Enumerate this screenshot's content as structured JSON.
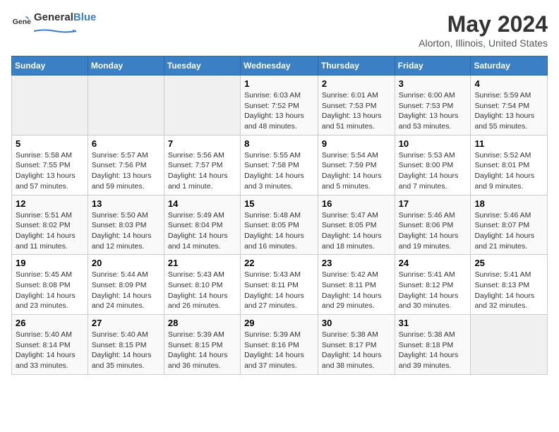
{
  "header": {
    "logo_general": "General",
    "logo_blue": "Blue",
    "title": "May 2024",
    "subtitle": "Alorton, Illinois, United States"
  },
  "days_of_week": [
    "Sunday",
    "Monday",
    "Tuesday",
    "Wednesday",
    "Thursday",
    "Friday",
    "Saturday"
  ],
  "weeks": [
    {
      "days": [
        {
          "number": "",
          "empty": true
        },
        {
          "number": "",
          "empty": true
        },
        {
          "number": "",
          "empty": true
        },
        {
          "number": "1",
          "sunrise": "6:03 AM",
          "sunset": "7:52 PM",
          "daylight": "13 hours and 48 minutes."
        },
        {
          "number": "2",
          "sunrise": "6:01 AM",
          "sunset": "7:53 PM",
          "daylight": "13 hours and 51 minutes."
        },
        {
          "number": "3",
          "sunrise": "6:00 AM",
          "sunset": "7:53 PM",
          "daylight": "13 hours and 53 minutes."
        },
        {
          "number": "4",
          "sunrise": "5:59 AM",
          "sunset": "7:54 PM",
          "daylight": "13 hours and 55 minutes."
        }
      ]
    },
    {
      "days": [
        {
          "number": "5",
          "sunrise": "5:58 AM",
          "sunset": "7:55 PM",
          "daylight": "13 hours and 57 minutes."
        },
        {
          "number": "6",
          "sunrise": "5:57 AM",
          "sunset": "7:56 PM",
          "daylight": "13 hours and 59 minutes."
        },
        {
          "number": "7",
          "sunrise": "5:56 AM",
          "sunset": "7:57 PM",
          "daylight": "14 hours and 1 minute."
        },
        {
          "number": "8",
          "sunrise": "5:55 AM",
          "sunset": "7:58 PM",
          "daylight": "14 hours and 3 minutes."
        },
        {
          "number": "9",
          "sunrise": "5:54 AM",
          "sunset": "7:59 PM",
          "daylight": "14 hours and 5 minutes."
        },
        {
          "number": "10",
          "sunrise": "5:53 AM",
          "sunset": "8:00 PM",
          "daylight": "14 hours and 7 minutes."
        },
        {
          "number": "11",
          "sunrise": "5:52 AM",
          "sunset": "8:01 PM",
          "daylight": "14 hours and 9 minutes."
        }
      ]
    },
    {
      "days": [
        {
          "number": "12",
          "sunrise": "5:51 AM",
          "sunset": "8:02 PM",
          "daylight": "14 hours and 11 minutes."
        },
        {
          "number": "13",
          "sunrise": "5:50 AM",
          "sunset": "8:03 PM",
          "daylight": "14 hours and 12 minutes."
        },
        {
          "number": "14",
          "sunrise": "5:49 AM",
          "sunset": "8:04 PM",
          "daylight": "14 hours and 14 minutes."
        },
        {
          "number": "15",
          "sunrise": "5:48 AM",
          "sunset": "8:05 PM",
          "daylight": "14 hours and 16 minutes."
        },
        {
          "number": "16",
          "sunrise": "5:47 AM",
          "sunset": "8:05 PM",
          "daylight": "14 hours and 18 minutes."
        },
        {
          "number": "17",
          "sunrise": "5:46 AM",
          "sunset": "8:06 PM",
          "daylight": "14 hours and 19 minutes."
        },
        {
          "number": "18",
          "sunrise": "5:46 AM",
          "sunset": "8:07 PM",
          "daylight": "14 hours and 21 minutes."
        }
      ]
    },
    {
      "days": [
        {
          "number": "19",
          "sunrise": "5:45 AM",
          "sunset": "8:08 PM",
          "daylight": "14 hours and 23 minutes."
        },
        {
          "number": "20",
          "sunrise": "5:44 AM",
          "sunset": "8:09 PM",
          "daylight": "14 hours and 24 minutes."
        },
        {
          "number": "21",
          "sunrise": "5:43 AM",
          "sunset": "8:10 PM",
          "daylight": "14 hours and 26 minutes."
        },
        {
          "number": "22",
          "sunrise": "5:43 AM",
          "sunset": "8:11 PM",
          "daylight": "14 hours and 27 minutes."
        },
        {
          "number": "23",
          "sunrise": "5:42 AM",
          "sunset": "8:11 PM",
          "daylight": "14 hours and 29 minutes."
        },
        {
          "number": "24",
          "sunrise": "5:41 AM",
          "sunset": "8:12 PM",
          "daylight": "14 hours and 30 minutes."
        },
        {
          "number": "25",
          "sunrise": "5:41 AM",
          "sunset": "8:13 PM",
          "daylight": "14 hours and 32 minutes."
        }
      ]
    },
    {
      "days": [
        {
          "number": "26",
          "sunrise": "5:40 AM",
          "sunset": "8:14 PM",
          "daylight": "14 hours and 33 minutes."
        },
        {
          "number": "27",
          "sunrise": "5:40 AM",
          "sunset": "8:15 PM",
          "daylight": "14 hours and 35 minutes."
        },
        {
          "number": "28",
          "sunrise": "5:39 AM",
          "sunset": "8:15 PM",
          "daylight": "14 hours and 36 minutes."
        },
        {
          "number": "29",
          "sunrise": "5:39 AM",
          "sunset": "8:16 PM",
          "daylight": "14 hours and 37 minutes."
        },
        {
          "number": "30",
          "sunrise": "5:38 AM",
          "sunset": "8:17 PM",
          "daylight": "14 hours and 38 minutes."
        },
        {
          "number": "31",
          "sunrise": "5:38 AM",
          "sunset": "8:18 PM",
          "daylight": "14 hours and 39 minutes."
        },
        {
          "number": "",
          "empty": true
        }
      ]
    }
  ]
}
